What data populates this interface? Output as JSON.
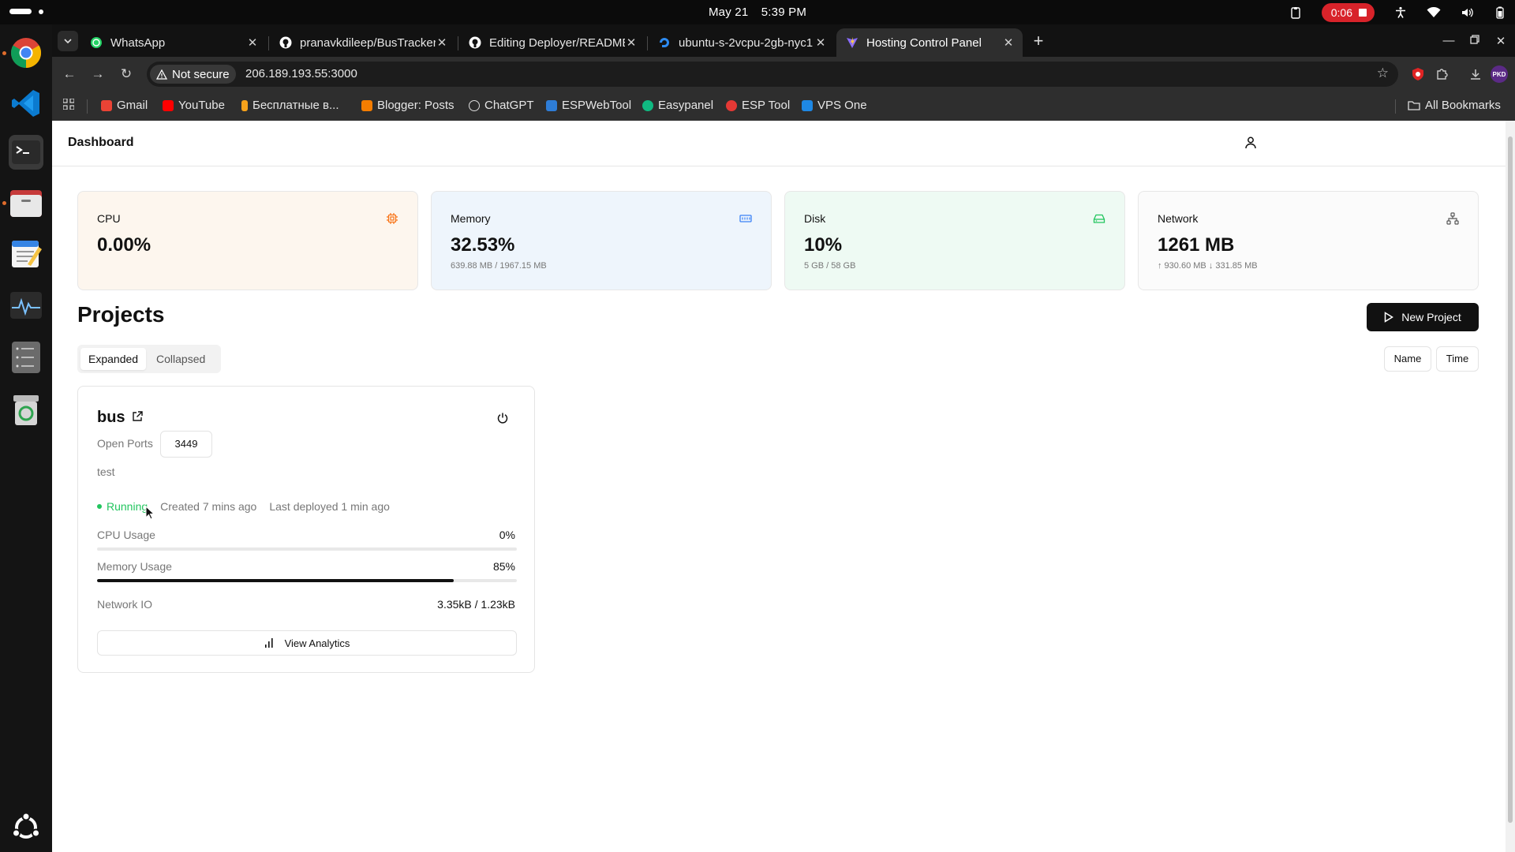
{
  "os": {
    "date": "May 21",
    "time": "5:39 PM",
    "recording_time": "0:06"
  },
  "browser": {
    "tabs": [
      {
        "title": "WhatsApp",
        "icon": "whatsapp-icon"
      },
      {
        "title": "pranavkdileep/BusTracker",
        "icon": "github-icon"
      },
      {
        "title": "Editing Deployer/README",
        "icon": "github-icon"
      },
      {
        "title": "ubuntu-s-2vcpu-2gb-nyc1",
        "icon": "digitalocean-icon"
      },
      {
        "title": "Hosting Control Panel",
        "icon": "vite-icon"
      }
    ],
    "security_label": "Not secure",
    "url": "206.189.193.55:3000",
    "profile_badge": "PKD",
    "bookmarks": [
      {
        "label": "Gmail",
        "color": "#ea4335"
      },
      {
        "label": "YouTube",
        "color": "#ff0000"
      },
      {
        "label": "Бесплатные в...",
        "color": "#f7a21b"
      },
      {
        "label": "Blogger: Posts",
        "color": "#f57d00"
      },
      {
        "label": "ChatGPT",
        "color": "#dddddd"
      },
      {
        "label": "ESPWebTool",
        "color": "#2e7dd7"
      },
      {
        "label": "Easypanel",
        "color": "#10b981"
      },
      {
        "label": "ESP Tool",
        "color": "#e53935"
      },
      {
        "label": "VPS One",
        "color": "#1e88e5"
      }
    ],
    "all_bookmarks_label": "All Bookmarks"
  },
  "app": {
    "header_title": "Dashboard",
    "stats": [
      {
        "label": "CPU",
        "value": "0.00%",
        "sub": "",
        "icon": "cpu-icon",
        "bg": "#fdf6ee",
        "accent": "#f97316"
      },
      {
        "label": "Memory",
        "value": "32.53%",
        "sub": "639.88 MB / 1967.15 MB",
        "icon": "memory-icon",
        "bg": "#eef5fc",
        "accent": "#3b82f6"
      },
      {
        "label": "Disk",
        "value": "10%",
        "sub": "5 GB / 58 GB",
        "icon": "disk-icon",
        "bg": "#eefaf3",
        "accent": "#22c55e"
      },
      {
        "label": "Network",
        "value": "1261 MB",
        "sub": "↑ 930.60 MB ↓ 331.85 MB",
        "icon": "network-icon",
        "bg": "#fbfbfb",
        "accent": "#555555"
      }
    ],
    "projects_title": "Projects",
    "new_project_label": "New Project",
    "view_modes": [
      "Expanded",
      "Collapsed"
    ],
    "active_view": "Expanded",
    "sort_options": [
      "Name",
      "Time"
    ],
    "project": {
      "name": "bus",
      "open_ports_label": "Open Ports",
      "ports": [
        "3449"
      ],
      "description": "test",
      "status": "Running",
      "created": "Created 7 mins ago",
      "last_deployed": "Last deployed 1 min ago",
      "cpu_label": "CPU Usage",
      "cpu_value": "0%",
      "cpu_fraction": 0.0,
      "memory_label": "Memory Usage",
      "memory_value": "85%",
      "memory_fraction": 0.85,
      "network_label": "Network IO",
      "network_value": "3.35kB / 1.23kB",
      "analytics_label": "View Analytics"
    }
  }
}
